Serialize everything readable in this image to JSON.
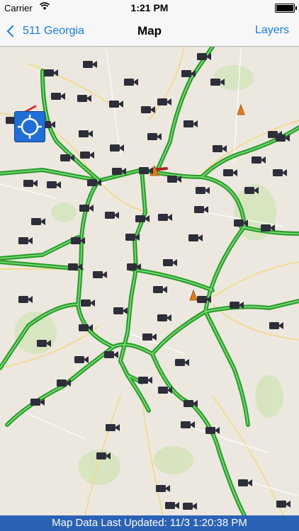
{
  "status_bar": {
    "carrier": "Carrier",
    "time": "1:21 PM"
  },
  "nav": {
    "back_label": "511 Georgia",
    "title": "Map",
    "right_label": "Layers"
  },
  "map": {
    "locate_button": "locate-me-icon",
    "marker_types": [
      "traffic-camera-icon",
      "construction-cone-icon"
    ]
  },
  "footer": {
    "text": "Map Data Last Updated: 11/3 1:20:38 PM"
  },
  "colors": {
    "accent": "#1a7cf4",
    "road_flow": "#2fb52f",
    "footer_bg": "#2a62b8"
  }
}
